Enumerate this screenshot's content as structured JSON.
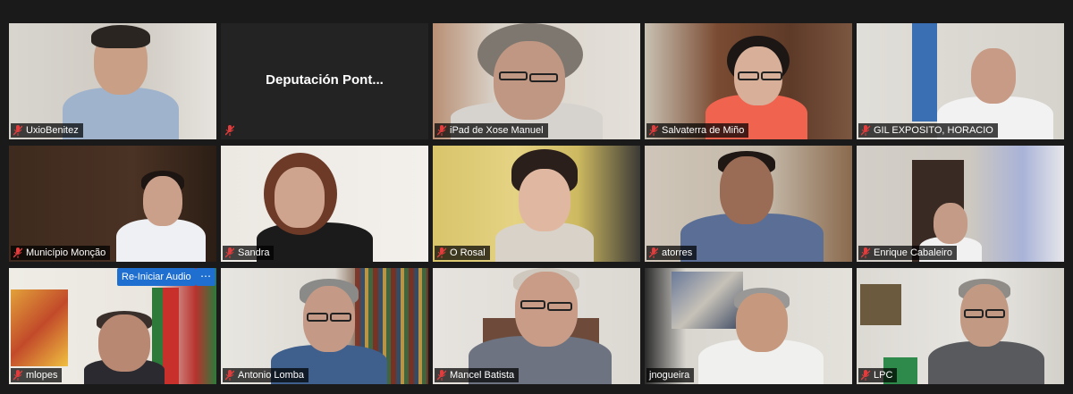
{
  "participants": [
    {
      "name": "UxioBenitez",
      "muted": true
    },
    {
      "name": "Deputación  Pont...",
      "muted": true,
      "video_off": true
    },
    {
      "name": "iPad de Xose Manuel",
      "muted": true
    },
    {
      "name": "Salvaterra de Miño",
      "muted": true
    },
    {
      "name": "GIL EXPOSITO, HORACIO",
      "muted": true
    },
    {
      "name": "Município Monção",
      "muted": true
    },
    {
      "name": "Sandra",
      "muted": true
    },
    {
      "name": "O Rosal",
      "muted": true
    },
    {
      "name": "atorres",
      "muted": true
    },
    {
      "name": "Enrique Cabaleiro",
      "muted": true
    },
    {
      "name": "mlopes",
      "muted": true
    },
    {
      "name": "Antonio Lomba",
      "muted": true
    },
    {
      "name": "Mancel Batista",
      "muted": true
    },
    {
      "name": "jnogueira",
      "muted": false,
      "active_speaker": true
    },
    {
      "name": "LPC",
      "muted": true
    }
  ],
  "controls": {
    "restart_audio_label": "Re-Iniciar Audio",
    "more_label": "⋯"
  },
  "colors": {
    "active_border": "#c9e14a",
    "mute_icon": "#e23c3c",
    "button": "#1f6fd1"
  }
}
